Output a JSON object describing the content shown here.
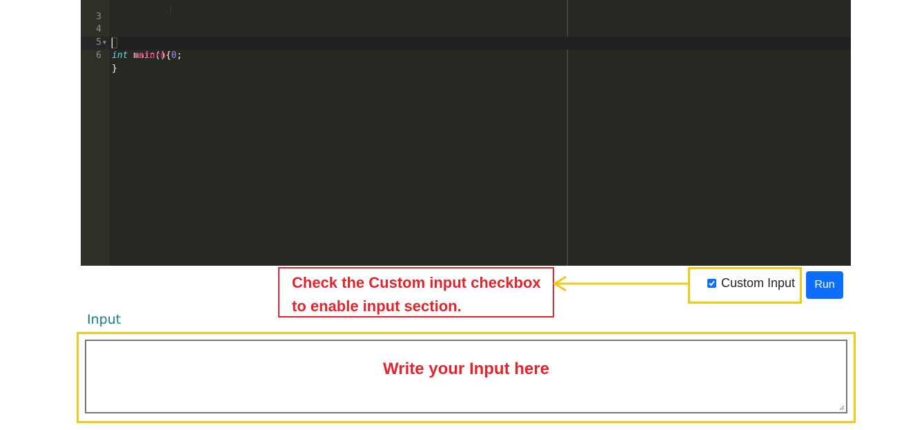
{
  "editor": {
    "lines": [
      {
        "num": "3",
        "fold": ""
      },
      {
        "num": "4",
        "fold": "▼"
      },
      {
        "num": "5",
        "fold": ""
      },
      {
        "num": "6",
        "fold": ""
      }
    ],
    "code": {
      "line4_type": "int",
      "line4_rest": " main(){",
      "line5_kw": "return",
      "line5_num": "0",
      "line5_end": ";",
      "line6": "}"
    }
  },
  "annotation": {
    "line1": "Check the Custom input checkbox",
    "line2": "to enable input section.",
    "color": "#e3242b"
  },
  "custom_input": {
    "label": "Custom Input",
    "checked": true
  },
  "run_button": {
    "label": "Run"
  },
  "input_section": {
    "label": "Input",
    "hint": "Write your Input here"
  },
  "colors": {
    "highlight_border": "#f5c518",
    "accent": "#0d6efd",
    "editor_bg": "#272822"
  }
}
